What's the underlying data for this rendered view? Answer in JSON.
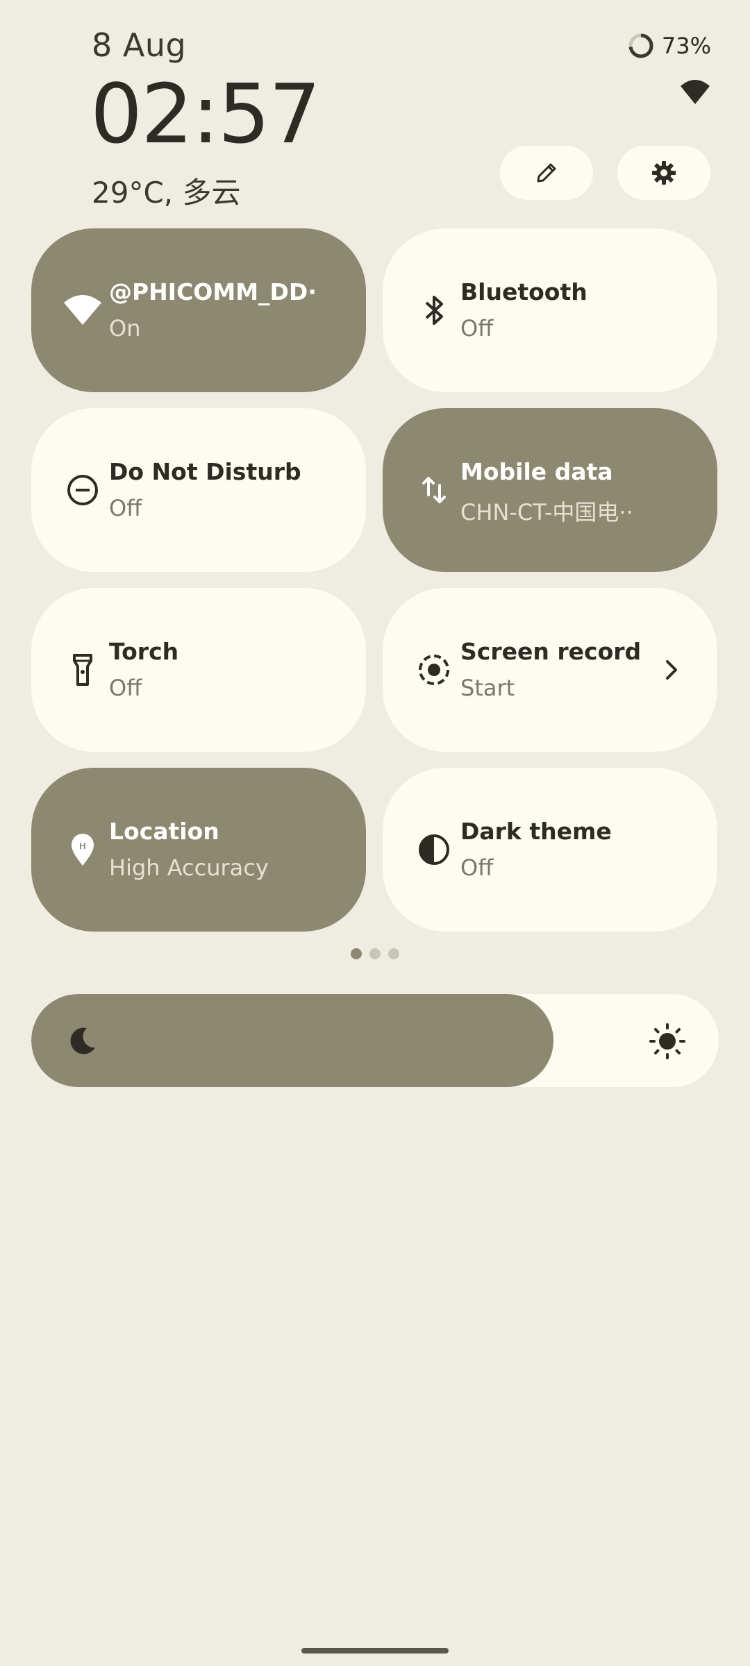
{
  "header": {
    "date": "8 Aug",
    "time": "02:57",
    "weather": "29°C, 多云",
    "battery_percent": "73%",
    "battery_level": 0.73
  },
  "actions": {
    "edit_icon": "pencil-icon",
    "settings_icon": "gear-icon"
  },
  "tiles": [
    {
      "title": "@PHICOMM_DD··",
      "subtitle": "On",
      "state": "on",
      "icon": "wifi-icon"
    },
    {
      "title": "Bluetooth",
      "subtitle": "Off",
      "state": "off",
      "icon": "bluetooth-icon"
    },
    {
      "title": "Do Not Disturb",
      "subtitle": "Off",
      "state": "off",
      "icon": "do-not-disturb-icon"
    },
    {
      "title": "Mobile data",
      "subtitle": "CHN-CT-中国电··",
      "state": "on",
      "icon": "mobile-data-icon"
    },
    {
      "title": "Torch",
      "subtitle": "Off",
      "state": "off",
      "icon": "torch-icon"
    },
    {
      "title": "Screen record",
      "subtitle": "Start",
      "state": "off",
      "icon": "screen-record-icon"
    },
    {
      "title": "Location",
      "subtitle": "High Accuracy",
      "state": "on",
      "icon": "location-icon"
    },
    {
      "title": "Dark theme",
      "subtitle": "Off",
      "state": "off",
      "icon": "dark-theme-icon"
    }
  ],
  "pager": {
    "pages": 3,
    "current": 1
  },
  "brightness": {
    "level": 0.76
  },
  "colors": {
    "background": "#efece2",
    "tile_on": "#8d8870",
    "tile_off": "#fdfcf0",
    "text": "#2c2b24"
  }
}
